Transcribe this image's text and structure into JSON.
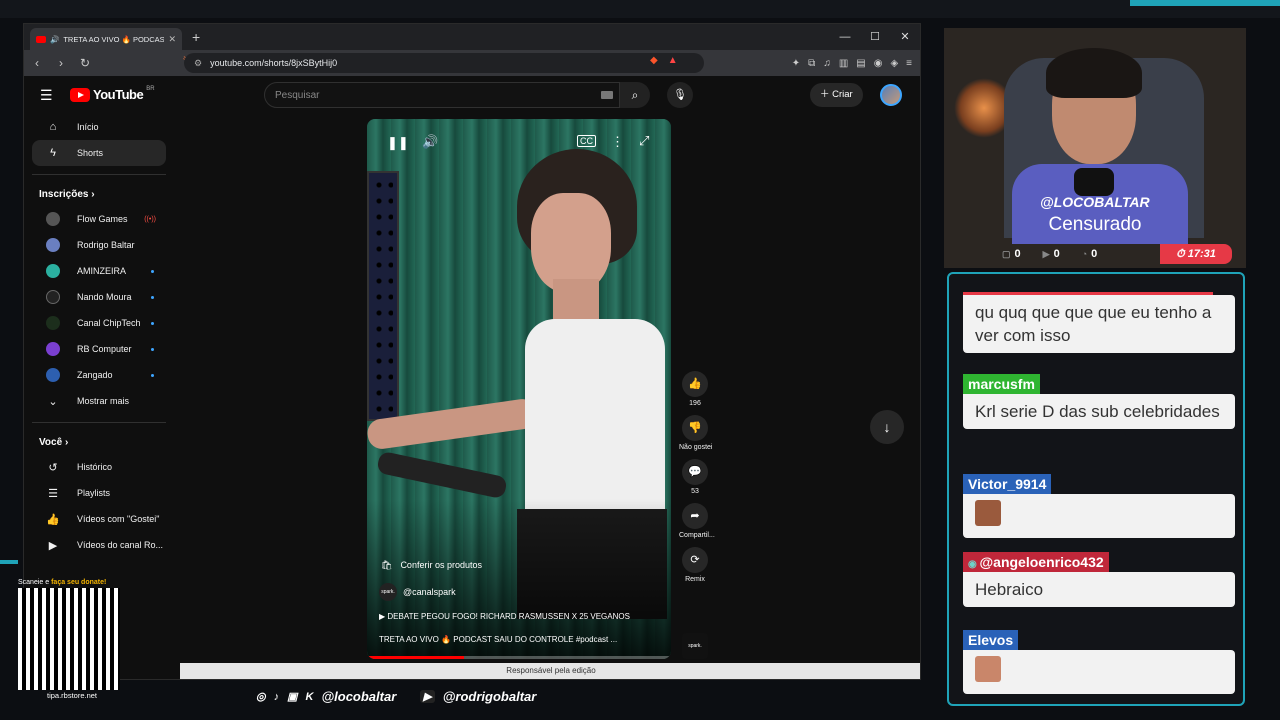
{
  "browser": {
    "tab_title": "TRETA AO VIVO 🔥 PODCAST SAIU",
    "url": "youtube.com/shorts/8jxSBytHij0"
  },
  "youtube": {
    "logo_text": "YouTube",
    "logo_region": "BR",
    "search_placeholder": "Pesquisar",
    "create_label": "Criar",
    "sidebar": {
      "primary": [
        {
          "label": "Início",
          "icon": "home-icon"
        },
        {
          "label": "Shorts",
          "icon": "shorts-icon",
          "active": true
        }
      ],
      "subscriptions_title": "Inscrições",
      "subscriptions": [
        {
          "label": "Flow Games",
          "status": "live"
        },
        {
          "label": "Rodrigo Baltar",
          "status": "none"
        },
        {
          "label": "AMINZEIRA",
          "status": "new"
        },
        {
          "label": "Nando Moura",
          "status": "new"
        },
        {
          "label": "Canal ChipTech",
          "status": "new"
        },
        {
          "label": "RB Computer",
          "status": "new"
        },
        {
          "label": "Zangado",
          "status": "new"
        }
      ],
      "show_more": "Mostrar mais",
      "you_title": "Você",
      "you_items": [
        {
          "label": "Histórico",
          "icon": "history-icon"
        },
        {
          "label": "Playlists",
          "icon": "playlist-icon"
        },
        {
          "label": "Vídeos com \"Gostei\"",
          "icon": "thumbs-up-icon"
        },
        {
          "label": "Vídeos do canal Ro...",
          "icon": "video-icon"
        }
      ]
    },
    "short": {
      "products_label": "Conferir os produtos",
      "channel": "@canalspark",
      "channel_avatar_text": "spark.",
      "title": "DEBATE PEGOU FOGO! RICHARD RASMUSSEN X 25 VEGANOS",
      "description": "TRETA AO VIVO 🔥 PODCAST SAIU DO CONTROLE #podcast ...",
      "progress": 0.32,
      "likes": "196",
      "dislike_label": "Não gostei",
      "comments": "53",
      "share_label": "Compartil...",
      "remix_label": "Remix",
      "sound_thumb_text": "spark."
    },
    "footer_notice": "Responsável pela edição"
  },
  "stream": {
    "cam_name": "@LOCOBALTAR",
    "cam_status": "Censurado",
    "stats": [
      "0",
      "0",
      "0"
    ],
    "timer": "17:31",
    "chat": [
      {
        "user": "",
        "text": "qu quq que que que eu tenho a ver com isso",
        "color": "#e63946"
      },
      {
        "user": "marcusfm",
        "text": "Krl serie D das sub celebridades",
        "color": "#2fb531"
      },
      {
        "user": "Victor_9914",
        "text": "",
        "color": "#2a62b8",
        "emote": true
      },
      {
        "user": "@angeloenrico432",
        "text": "Hebraico",
        "color": "#c0273a"
      },
      {
        "user": "Elevos",
        "text": "",
        "color": "#2a62b8",
        "emote": true
      }
    ],
    "socials": [
      "@locobaltar",
      "@rodrigobaltar"
    ],
    "qr_caption_pre": "Scaneie e",
    "qr_caption_bold": "faça seu donate!",
    "qr_site": "tipa.rbstore.net"
  }
}
